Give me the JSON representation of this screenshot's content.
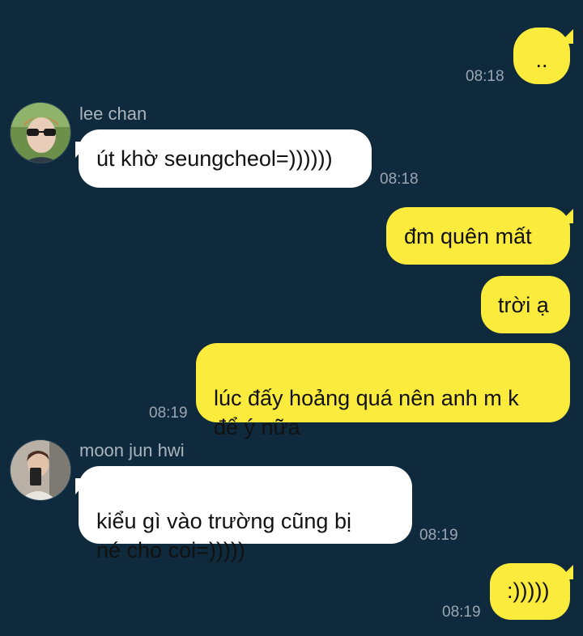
{
  "messages": [
    {
      "side": "out",
      "text": "..",
      "time": "08:18"
    },
    {
      "side": "in",
      "sender": "lee chan",
      "text": "út khờ seungcheol=))))))",
      "time": "08:18"
    },
    {
      "side": "out",
      "text": "đm quên mất"
    },
    {
      "side": "out",
      "text": "trời ạ"
    },
    {
      "side": "out",
      "text": "lúc đấy hoảng quá nên anh m k\nđể ý nữa",
      "time": "08:19"
    },
    {
      "side": "in",
      "sender": "moon jun hwi",
      "text": "kiểu gì vào trường cũng bị\nné cho coi=)))))",
      "time": "08:19"
    },
    {
      "side": "out",
      "text": ":)))))",
      "time": "08:19"
    }
  ],
  "colors": {
    "background": "#0f2a3d",
    "outgoing_bubble": "#fbeb3c",
    "incoming_bubble": "#ffffff",
    "timestamp": "#9aa7b2",
    "sender_name": "#aab4bd"
  },
  "icons": {
    "avatar_lee_chan": "profile-photo",
    "avatar_moon_jun_hwi": "profile-photo"
  }
}
